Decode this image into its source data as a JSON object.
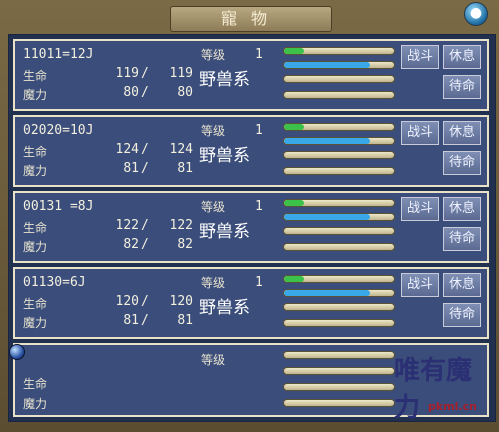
{
  "window": {
    "title": "寵物",
    "close_icon": "globe-icon"
  },
  "labels": {
    "level": "等级",
    "hp": "生命",
    "mp": "魔力",
    "slash": "/"
  },
  "buttons": {
    "battle": "战斗",
    "rest": "休息",
    "standby": "待命"
  },
  "colors": {
    "hp_fill": "#38a8e8",
    "exp_fill": "#3cc24a",
    "card": "#3b4d7a",
    "card_border": "#e9e2c8"
  },
  "pets": [
    {
      "name": "11011=12J",
      "level": "1",
      "hp_cur": "119",
      "hp_max": "119",
      "mp_cur": "80",
      "mp_max": "80",
      "type": "野兽系",
      "exp_ratio": 0.18,
      "hp_ratio": 0.78,
      "show_battle": true
    },
    {
      "name": "02020=10J",
      "level": "1",
      "hp_cur": "124",
      "hp_max": "124",
      "mp_cur": "81",
      "mp_max": "81",
      "type": "野兽系",
      "exp_ratio": 0.18,
      "hp_ratio": 0.78,
      "show_battle": true
    },
    {
      "name": "00131 =8J",
      "level": "1",
      "hp_cur": "122",
      "hp_max": "122",
      "mp_cur": "82",
      "mp_max": "82",
      "type": "野兽系",
      "exp_ratio": 0.18,
      "hp_ratio": 0.78,
      "show_battle": true
    },
    {
      "name": "01130=6J",
      "level": "1",
      "hp_cur": "120",
      "hp_max": "120",
      "mp_cur": "81",
      "mp_max": "81",
      "type": "野兽系",
      "exp_ratio": 0.18,
      "hp_ratio": 0.78,
      "show_battle": true
    }
  ],
  "empty_slot": {
    "level": "等级",
    "hp": "生命",
    "mp": "魔力"
  },
  "watermark": {
    "logo_text": "唯有魔力",
    "url": "pkml.cn"
  }
}
